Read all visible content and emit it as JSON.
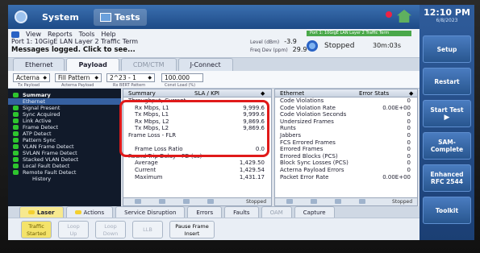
{
  "topbar": {
    "tabs": [
      {
        "label": "System"
      },
      {
        "label": "Tests"
      }
    ]
  },
  "clock": {
    "time": "12:10 PM",
    "date": "6/8/2023"
  },
  "side_buttons": [
    {
      "label": "Setup"
    },
    {
      "label": "Restart"
    },
    {
      "label": "Start Test"
    },
    {
      "label": "SAM-Complete"
    },
    {
      "label": "Enhanced RFC 2544"
    },
    {
      "label": "Toolkit"
    }
  ],
  "menu": [
    "View",
    "Reports",
    "Tools",
    "Help"
  ],
  "header": {
    "title_line": "Port 1: 10GigE LAN Layer 2 Traffic Term",
    "messages": "Messages logged. Click to see...",
    "level_label": "Level (dBm)",
    "level_value": "-3.9",
    "freq_label": "Freq Dev (ppm)",
    "freq_value": "29.9",
    "status": "Stopped",
    "elapsed": "30m:03s",
    "banner": "Port 1: 10GigE LAN Layer 2 Traffic Term"
  },
  "config_tabs": [
    {
      "label": "Ethernet",
      "active": false,
      "dim": false
    },
    {
      "label": "Payload",
      "active": true,
      "dim": false
    },
    {
      "label": "CDM/CTM",
      "active": false,
      "dim": true
    },
    {
      "label": "J-Connect",
      "active": false,
      "dim": false
    }
  ],
  "config_fields": {
    "tx_payload": "Acterna",
    "tx_payload_caption": "Tx Payload",
    "acterna_payload": "Fill Pattern",
    "acterna_payload_caption": "Acterna Payload",
    "bert_pattern": "2^23 - 1",
    "bert_pattern_caption": "Rx BERT Pattern",
    "const_load": "100.000",
    "const_load_caption": "Const Load (%)"
  },
  "tree": [
    {
      "label": "Summary",
      "type": "header",
      "led": true
    },
    {
      "label": "Ethernet",
      "type": "selected",
      "led": false
    },
    {
      "label": "Signal Present",
      "type": "item",
      "led": true
    },
    {
      "label": "Sync Acquired",
      "type": "item",
      "led": true
    },
    {
      "label": "Link Active",
      "type": "item",
      "led": true
    },
    {
      "label": "Frame Detect",
      "type": "item",
      "led": true
    },
    {
      "label": "ATP Detect",
      "type": "item",
      "led": true
    },
    {
      "label": "Pattern Sync",
      "type": "item",
      "led": true
    },
    {
      "label": "VLAN Frame Detect",
      "type": "item",
      "led": true
    },
    {
      "label": "SVLAN Frame Detect",
      "type": "item",
      "led": true
    },
    {
      "label": "Stacked VLAN Detect",
      "type": "item",
      "led": true
    },
    {
      "label": "Local Fault Detect",
      "type": "item",
      "led": true
    },
    {
      "label": "Remote Fault Detect",
      "type": "item",
      "led": true
    },
    {
      "label": "History",
      "type": "plain",
      "led": false
    }
  ],
  "mid_panel": {
    "col1": "Summary",
    "col2": "SLA / KPI",
    "rows": [
      {
        "label": "Throughput, Current",
        "value": "",
        "indent": false
      },
      {
        "label": "Rx Mbps, L1",
        "value": "9,999.6",
        "indent": true
      },
      {
        "label": "Tx Mbps, L1",
        "value": "9,999.6",
        "indent": true
      },
      {
        "label": "Rx Mbps, L2",
        "value": "9,869.6",
        "indent": true
      },
      {
        "label": "Tx Mbps, L2",
        "value": "9,869.6",
        "indent": true
      },
      {
        "label": "Frame Loss - FLR",
        "value": "",
        "indent": false
      },
      {
        "label": "",
        "value": "",
        "indent": true
      },
      {
        "label": "Frame Loss Ratio",
        "value": "0.0",
        "indent": true
      },
      {
        "label": "Round Trip Delay - FD (us)",
        "value": "",
        "indent": false
      },
      {
        "label": "Average",
        "value": "1,429.50",
        "indent": true
      },
      {
        "label": "Current",
        "value": "1,429.54",
        "indent": true
      },
      {
        "label": "Maximum",
        "value": "1,431.17",
        "indent": true
      }
    ],
    "footer_status": "Stopped"
  },
  "right_panel": {
    "col1": "Ethernet",
    "col2": "Error Stats",
    "rows": [
      {
        "label": "Code Violations",
        "value": "0"
      },
      {
        "label": "Code Violation Rate",
        "value": "0.00E+00"
      },
      {
        "label": "Code Violation Seconds",
        "value": "0"
      },
      {
        "label": "Undersized Frames",
        "value": "0"
      },
      {
        "label": "Runts",
        "value": "0"
      },
      {
        "label": "Jabbers",
        "value": "0"
      },
      {
        "label": "FCS Errored Frames",
        "value": "0"
      },
      {
        "label": "Errored Frames",
        "value": "0"
      },
      {
        "label": "Errored Blocks (PCS)",
        "value": "0"
      },
      {
        "label": "Block Sync Losses (PCS)",
        "value": "0"
      },
      {
        "label": "Acterna Payload Errors",
        "value": "0"
      },
      {
        "label": "Packet Error Rate",
        "value": "0.00E+00"
      }
    ],
    "footer_status": "Stopped"
  },
  "bottom_tabs": [
    {
      "label": "Laser",
      "active": true,
      "dim": false
    },
    {
      "label": "Actions",
      "active": false,
      "dim": false
    },
    {
      "label": "Service Disruption",
      "active": false,
      "dim": false
    },
    {
      "label": "Errors",
      "active": false,
      "dim": false
    },
    {
      "label": "Faults",
      "active": false,
      "dim": false
    },
    {
      "label": "OAM",
      "active": false,
      "dim": true
    },
    {
      "label": "Capture",
      "active": false,
      "dim": false
    }
  ],
  "action_buttons": [
    {
      "line1": "Traffic",
      "line2": "Started",
      "style": "yellow"
    },
    {
      "line1": "Loop",
      "line2": "Up",
      "style": "dim"
    },
    {
      "line1": "Loop",
      "line2": "Down",
      "style": "dim"
    },
    {
      "line1": "LLB",
      "line2": "",
      "style": "dim"
    },
    {
      "line1": "Pause Frame",
      "line2": "Insert",
      "style": "normal"
    }
  ]
}
